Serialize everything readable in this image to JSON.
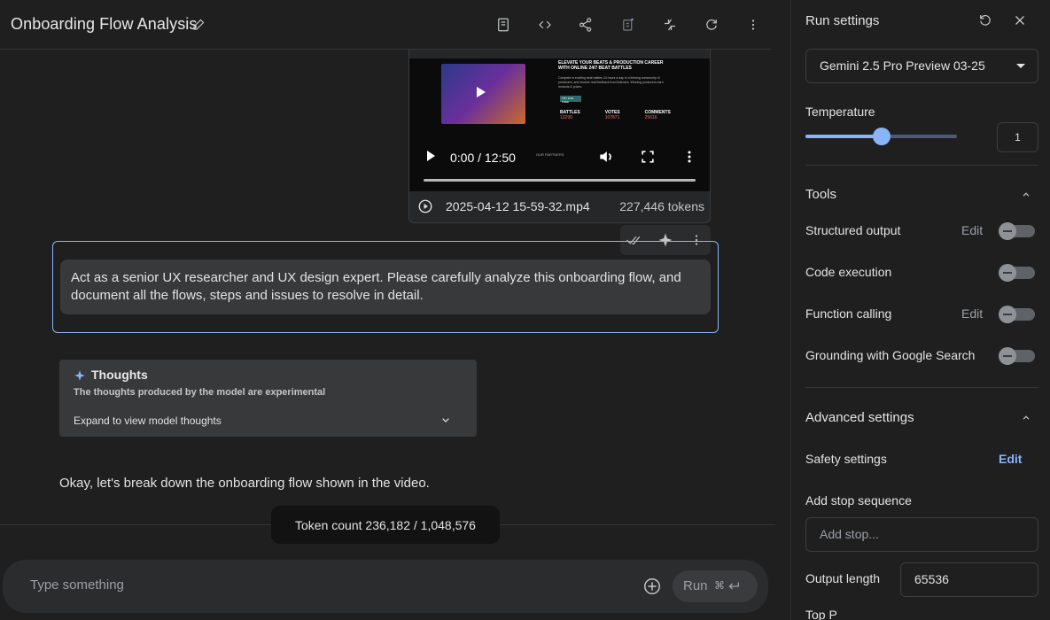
{
  "header": {
    "title": "Onboarding Flow Analysis",
    "icons": [
      "save-icon",
      "code-icon",
      "share-icon",
      "compare-icon",
      "compress-icon",
      "refresh-icon",
      "more-vert-icon"
    ]
  },
  "video": {
    "headline": "ELEVATE YOUR BEATS & PRODUCTION CAREER WITH ONLINE 24/7 BEAT BATTLES",
    "body": "Compete in exciting beat battles 24 hours a day in a thriving community of producers, and receive real feedback from listeners. Winning producers earn rewards & prizes.",
    "cta": "TRY FOR FREE",
    "stats": [
      {
        "label": "BATTLES",
        "value": "13290"
      },
      {
        "label": "VOTES",
        "value": "107871"
      },
      {
        "label": "COMMENTS",
        "value": "25616"
      }
    ],
    "partners": "OUR PARTNERS",
    "time": "0:00 / 12:50",
    "filename": "2025-04-12 15-59-32.mp4",
    "tokens": "227,446 tokens"
  },
  "prompt": {
    "text": "Act as a senior UX researcher and UX design expert. Please carefully analyze this onboarding flow, and document all the flows, steps and issues to resolve in detail."
  },
  "thoughts": {
    "title": "Thoughts",
    "subtitle": "The thoughts produced by the model are experimental",
    "expand": "Expand to view model thoughts"
  },
  "reply": {
    "text": "Okay, let's break down the onboarding flow shown in the video."
  },
  "token_count": "Token count 236,182 / 1,048,576",
  "composer": {
    "placeholder": "Type something",
    "run_label": "Run",
    "run_kbd": "⌘"
  },
  "settings": {
    "title": "Run settings",
    "model": "Gemini 2.5 Pro Preview 03-25",
    "temperature_label": "Temperature",
    "temperature_value": "1",
    "temperature_fraction": 0.5,
    "tools_title": "Tools",
    "tools": [
      {
        "label": "Structured output",
        "edit": "Edit",
        "enabled": false
      },
      {
        "label": "Code execution",
        "edit": "",
        "enabled": false
      },
      {
        "label": "Function calling",
        "edit": "Edit",
        "enabled": false
      },
      {
        "label": "Grounding with Google Search",
        "edit": "",
        "enabled": false
      }
    ],
    "advanced_title": "Advanced settings",
    "safety_label": "Safety settings",
    "safety_edit": "Edit",
    "stop_label": "Add stop sequence",
    "stop_placeholder": "Add stop...",
    "output_label": "Output length",
    "output_value": "65536",
    "top_p_label": "Top P"
  },
  "colors": {
    "accent": "#8ab4f8",
    "background": "#1f1f20",
    "surface": "#38393a"
  }
}
